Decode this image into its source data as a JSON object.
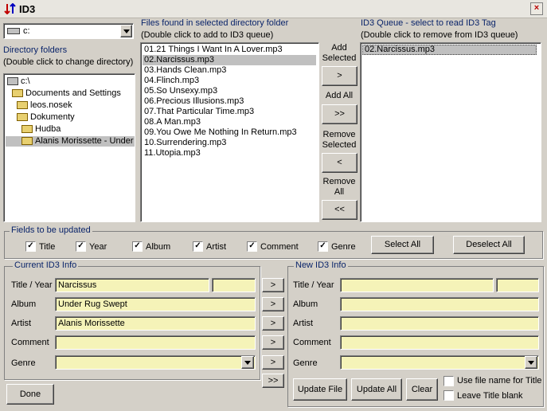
{
  "window": {
    "title": "ID3",
    "close": "×"
  },
  "drive": {
    "value": "c:"
  },
  "dirs": {
    "label": "Directory folders",
    "hint": "(Double click to change directory)",
    "items": [
      "c:\\",
      "Documents and Settings",
      "leos.nosek",
      "Dokumenty",
      "Hudba",
      "Alanis Morissette - Under R"
    ]
  },
  "files": {
    "label": "Files found in selected directory folder",
    "hint": "(Double click to add to ID3 queue)",
    "items": [
      "01.21 Things I Want In A Lover.mp3",
      "02.Narcissus.mp3",
      "03.Hands Clean.mp3",
      "04.Flinch.mp3",
      "05.So Unsexy.mp3",
      "06.Precious Illusions.mp3",
      "07.That Particular Time.mp3",
      "08.A Man.mp3",
      "09.You Owe Me Nothing In Return.mp3",
      "10.Surrendering.mp3",
      "11.Utopia.mp3"
    ]
  },
  "queue": {
    "label": "ID3 Queue - select to read ID3 Tag",
    "hint": "(Double click to remove from ID3 queue)",
    "items": [
      "02.Narcissus.mp3"
    ]
  },
  "mid": {
    "add_selected": "Add Selected",
    "add_selected_btn": ">",
    "add_all": "Add All",
    "add_all_btn": ">>",
    "remove_selected": "Remove Selected",
    "remove_selected_btn": "<",
    "remove_all": "Remove All",
    "remove_all_btn": "<<"
  },
  "fields": {
    "label": "Fields to be updated",
    "title": "Title",
    "year": "Year",
    "album": "Album",
    "artist": "Artist",
    "comment": "Comment",
    "genre": "Genre",
    "check": "✓",
    "select_all": "Select All",
    "deselect_all": "Deselect All"
  },
  "current": {
    "label": "Current ID3 Info",
    "title_year_label": "Title / Year",
    "album_label": "Album",
    "artist_label": "Artist",
    "comment_label": "Comment",
    "genre_label": "Genre",
    "title": "Narcissus",
    "year": "",
    "album": "Under Rug Swept",
    "artist": "Alanis Morissette",
    "comment": "",
    "genre": ""
  },
  "copy": {
    "one": ">",
    "all": ">>"
  },
  "newinfo": {
    "label": "New ID3 Info",
    "title_year_label": "Title / Year",
    "album_label": "Album",
    "artist_label": "Artist",
    "comment_label": "Comment",
    "genre_label": "Genre",
    "title": "",
    "year": "",
    "album": "",
    "artist": "",
    "comment": "",
    "genre": ""
  },
  "actions": {
    "done": "Done",
    "update_file": "Update File",
    "update_all": "Update All",
    "clear": "Clear",
    "use_file_name": "Use file name for Title",
    "leave_title_blank": "Leave Title blank"
  }
}
